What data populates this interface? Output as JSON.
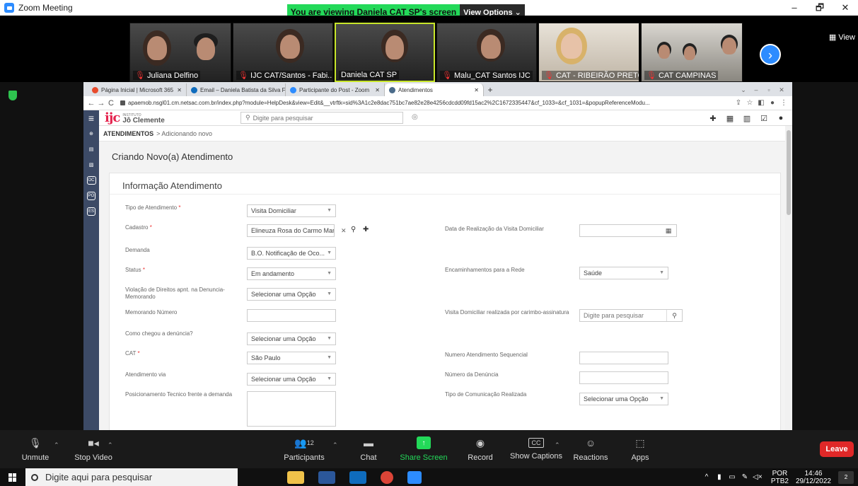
{
  "zoom": {
    "title": "Zoom Meeting",
    "share_banner": "You are viewing Daniela CAT SP's screen",
    "view_options": "View Options ⌄",
    "view_label": "View",
    "window_controls": [
      "–",
      "🗗",
      "✕"
    ]
  },
  "participants": [
    {
      "name": "Juliana Delfino",
      "muted": true
    },
    {
      "name": "IJC CAT/Santos - Fabi...",
      "muted": true
    },
    {
      "name": "Daniela CAT SP",
      "muted": false
    },
    {
      "name": "Malu_CAT Santos IJC",
      "muted": true
    },
    {
      "name": "CAT - RIBEIRÃO PRETO",
      "muted": true
    },
    {
      "name": "CAT CAMPINAS",
      "muted": true
    }
  ],
  "browser": {
    "tabs": [
      {
        "label": "Página Inicial | Microsoft 365",
        "color": "#e84b2c"
      },
      {
        "label": "Email – Daniela Batista da Silva F",
        "color": "#0f6cbd"
      },
      {
        "label": "Participante do Post - Zoom",
        "color": "#2d8cff"
      },
      {
        "label": "Atendimentos",
        "color": "#4a6b8a"
      }
    ],
    "new_tab": "+",
    "url": "apaemob.nsgl01.cm.netsac.com.br/index.php?module=HelpDesk&view=Edit&__vtrftk=sid%3A1c2e8dac751bc7ae82e28e4256cdcdd09fd15ac2%2C1672335447&cf_1033=&cf_1031=&popupReferenceModu..."
  },
  "app": {
    "logo_mark": "ijc",
    "logo_small": "INSTITUTO",
    "logo_name": "Jô Clemente",
    "search_placeholder": "Digite para pesquisar",
    "breadcrumb_main": "ATENDIMENTOS",
    "breadcrumb_sub": "> Adicionando novo",
    "page_title": "Criando Novo(a) Atendimento",
    "section_title": "Informação Atendimento",
    "sidebar": [
      "OC",
      "PO",
      "ES"
    ]
  },
  "form": {
    "tipo_label": "Tipo de Atendimento",
    "tipo_value": "Visita Domiciliar",
    "cadastro_label": "Cadastro",
    "cadastro_value": "Elineuza Rosa do Carmo Marche",
    "demanda_label": "Demanda",
    "demanda_value": "B.O. Notificação de Oco...",
    "status_label": "Status",
    "status_value": "Em andamento",
    "violacao_label": "Violação de Direitos apnt. na Denuncia-Memorando",
    "violacao_value": "Selecionar uma Opção",
    "memorando_label": "Memorando Número",
    "chegou_label": "Como chegou a denúncia?",
    "chegou_value": "Selecionar uma Opção",
    "cat_label": "CAT",
    "cat_value": "São Paulo",
    "via_label": "Atendimento via",
    "via_value": "Selecionar uma Opção",
    "posicionamento_label": "Posicionamento Tecnico frente a demanda",
    "data_visita_label": "Data de Realização da Visita Domiciliar",
    "encaminhamentos_label": "Encaminhamentos para a Rede",
    "encaminhamentos_value": "Saúde",
    "visita_carimbo_label": "Visita Domiciliar realizada por carimbo-assinatura",
    "visita_carimbo_placeholder": "Digite para pesquisar",
    "numero_seq_label": "Numero Atendimento Sequencial",
    "numero_denuncia_label": "Número da Denúncia",
    "comunicacao_label": "Tipo de Comunicação Realizada",
    "comunicacao_value": "Selecionar uma Opção"
  },
  "controls": {
    "unmute": "Unmute",
    "stop_video": "Stop Video",
    "participants": "Participants",
    "participants_count": "12",
    "chat": "Chat",
    "share_screen": "Share Screen",
    "record": "Record",
    "show_captions": "Show Captions",
    "reactions": "Reactions",
    "apps": "Apps",
    "leave": "Leave"
  },
  "taskbar": {
    "search_placeholder": "Digite aqui para pesquisar",
    "lang_1": "POR",
    "lang_2": "PTB2",
    "time": "14:46",
    "date": "29/12/2022",
    "notifications": "2"
  }
}
